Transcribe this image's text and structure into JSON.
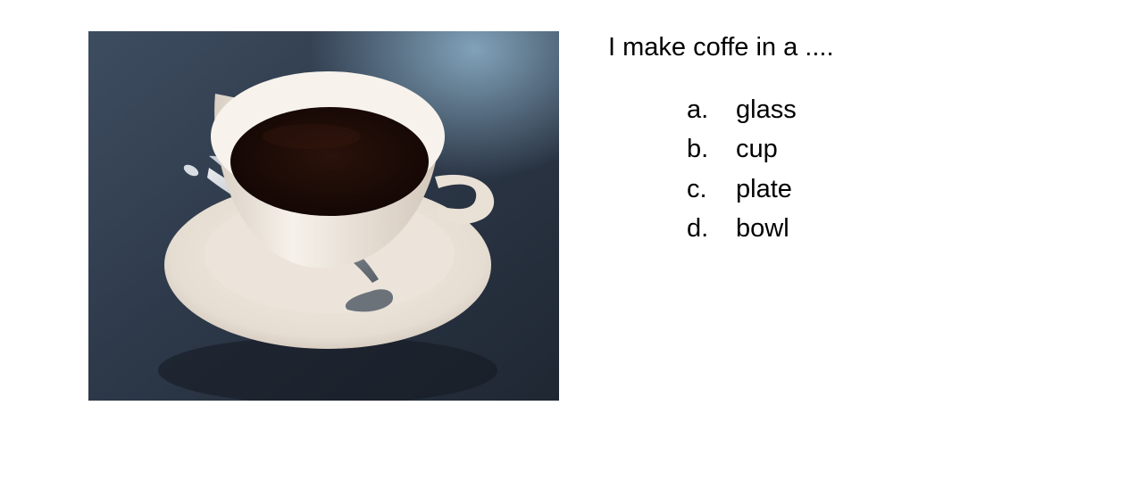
{
  "question": "I make coffe in a ....",
  "options": [
    {
      "letter": "a.",
      "text": "glass"
    },
    {
      "letter": "b.",
      "text": "cup"
    },
    {
      "letter": "c.",
      "text": "plate"
    },
    {
      "letter": "d.",
      "text": "bowl"
    }
  ]
}
